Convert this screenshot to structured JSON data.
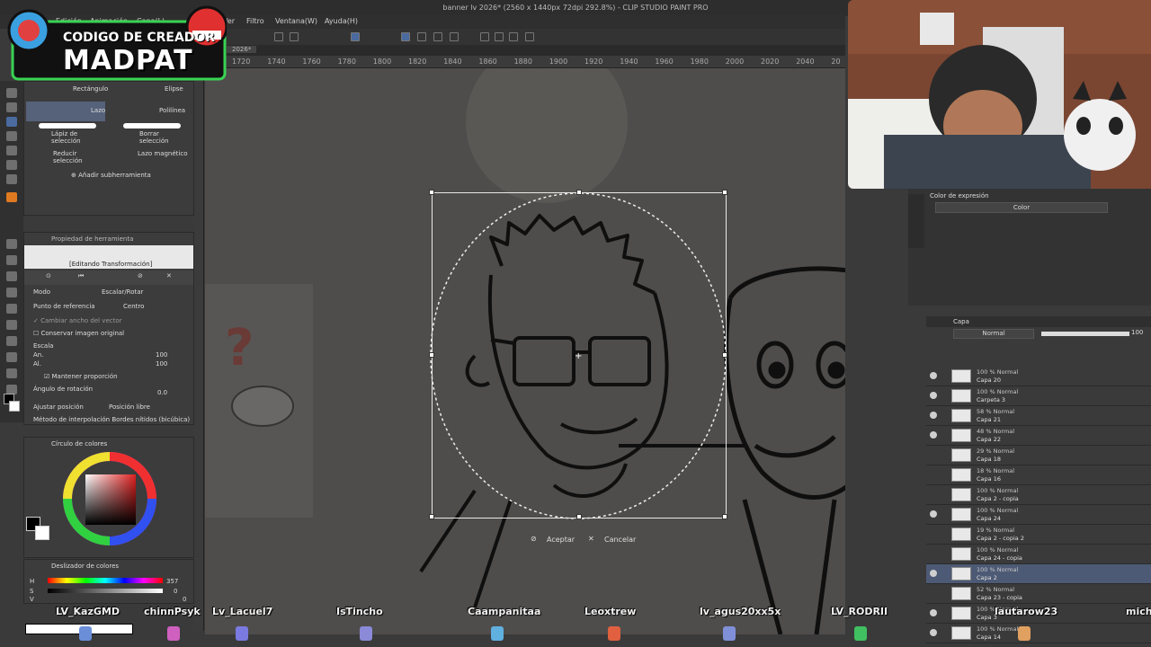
{
  "window": {
    "title": "banner lv 2026* (2560 x 1440px 72dpi 292.8%) - CLIP STUDIO PAINT PRO"
  },
  "menu": {
    "items": [
      "Edición",
      "Animación",
      "Capa(L)",
      "Ver",
      "Filtro",
      "Ventana(W)",
      "Ayuda(H)"
    ]
  },
  "tab": {
    "label": "2026*"
  },
  "ruler": {
    "ticks": [
      "1720",
      "1740",
      "1760",
      "1780",
      "1800",
      "1820",
      "1840",
      "1860",
      "1880",
      "1900",
      "1920",
      "1940",
      "1960",
      "1980",
      "2000",
      "2020",
      "2040",
      "20"
    ]
  },
  "logo": {
    "line1": "CODIGO DE CREADOR",
    "line2": "MADPAT"
  },
  "subtools": {
    "rectangulo": "Rectángulo",
    "elipse": "Elipse",
    "lazo": "Lazo",
    "polilinea": "Polilínea",
    "lapiz": "Lápiz de selección",
    "borrar": "Borrar selección",
    "reducir": "Reducir selección",
    "lazo_magnetico": "Lazo magnético",
    "add_subtool": "Añadir subherramienta"
  },
  "tool_property": {
    "panel_title": "Propiedad de herramienta",
    "header": "[Editando Transformación]",
    "modo_label": "Modo",
    "modo_value": "Escalar/Rotar",
    "ref_label": "Punto de referencia",
    "ref_value": "Centro",
    "cambiar_ancho": "Cambiar ancho del vector",
    "conservar": "Conservar imagen original",
    "escala": "Escala",
    "an": "An.",
    "al": "Al.",
    "an_value": "100",
    "al_value": "100",
    "mantener": "Mantener proporción",
    "angulo": "Ángulo de rotación",
    "angulo_value": "0.0",
    "ajustar": "Ajustar posición",
    "ajustar_value": "Posición libre",
    "metodo": "Método de interpolación",
    "metodo_value": "Bordes nítidos (bicúbica)"
  },
  "color_panel": {
    "title": "Círculo de colores",
    "slider_title": "Deslizador de colores",
    "h_label": "H",
    "h_value": "357",
    "s_label": "S",
    "s_value": "0",
    "v_label": "V",
    "v_value": "0"
  },
  "confirm": {
    "accept": "Aceptar",
    "cancel": "Cancelar"
  },
  "right_panel": {
    "title": "Color de expresión",
    "value": "Color"
  },
  "layers": {
    "tab": "Capa",
    "blend": "Normal",
    "opacity": "100",
    "rows": [
      {
        "pct": "100 % Normal",
        "name": "Capa 20",
        "selected": false
      },
      {
        "pct": "100 % Normal",
        "name": "Carpeta 3",
        "selected": false
      },
      {
        "pct": "58 % Normal",
        "name": "Capa 21",
        "selected": false
      },
      {
        "pct": "48 % Normal",
        "name": "Capa 22",
        "selected": false
      },
      {
        "pct": "29 % Normal",
        "name": "Capa 18",
        "selected": false
      },
      {
        "pct": "18 % Normal",
        "name": "Capa 16",
        "selected": false
      },
      {
        "pct": "100 % Normal",
        "name": "Capa 2 - copia",
        "selected": false
      },
      {
        "pct": "100 % Normal",
        "name": "Capa 24",
        "selected": false
      },
      {
        "pct": "19 % Normal",
        "name": "Capa 2 - copia 2",
        "selected": false
      },
      {
        "pct": "100 % Normal",
        "name": "Capa 24 - copia",
        "selected": false
      },
      {
        "pct": "100 % Normal",
        "name": "Capa 2",
        "selected": true
      },
      {
        "pct": "52 % Normal",
        "name": "Capa 23 - copia",
        "selected": false
      },
      {
        "pct": "100 % Normal",
        "name": "Capa 3",
        "selected": false
      },
      {
        "pct": "100 % Normal",
        "name": "Capa 14",
        "selected": false
      }
    ]
  },
  "viewers": [
    "LV_KazGMD",
    "chinnPsyk",
    "Lv_Lacuel7",
    "IsTincho",
    "Caampanitaa",
    "Leoxtrew",
    "lv_agus20xx5x",
    "LV_RODRII",
    "lautarow23",
    "mich"
  ],
  "colors": {
    "accent": "#3b78d8",
    "logo_green": "#39d353",
    "selected_layer": "#4d5a75"
  }
}
